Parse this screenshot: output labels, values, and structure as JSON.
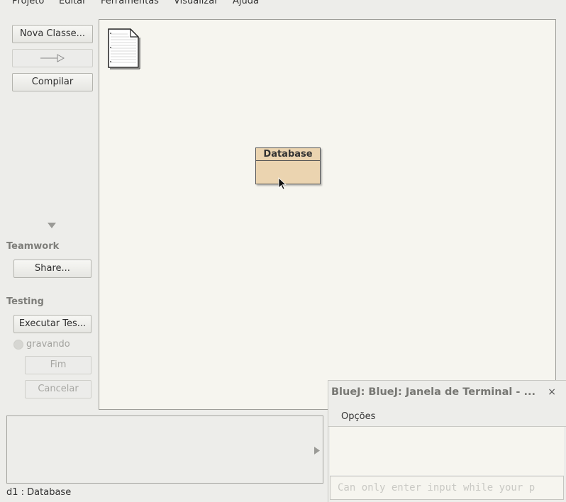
{
  "menubar": {
    "items": [
      "Projeto",
      "Editar",
      "Ferramentas",
      "Visualizar",
      "Ajuda"
    ]
  },
  "toolbar": {
    "new_class_label": "Nova Classe...",
    "compile_label": "Compilar"
  },
  "teamwork": {
    "title": "Teamwork",
    "share_label": "Share..."
  },
  "testing": {
    "title": "Testing",
    "run_tests_label": "Executar Tes...",
    "recording_label": "gravando",
    "end_label": "Fim",
    "cancel_label": "Cancelar"
  },
  "canvas": {
    "class_name": "Database"
  },
  "status": {
    "text": "d1 : Database"
  },
  "terminal": {
    "title": "BlueJ: BlueJ:  Janela de Terminal - ...",
    "close_label": "×",
    "menu_options": "Opções",
    "input_placeholder": "Can only enter input while your p"
  },
  "colors": {
    "class_fill": "#ebd4b0",
    "canvas_bg": "#f6f5ef",
    "window_bg": "#ededea"
  }
}
